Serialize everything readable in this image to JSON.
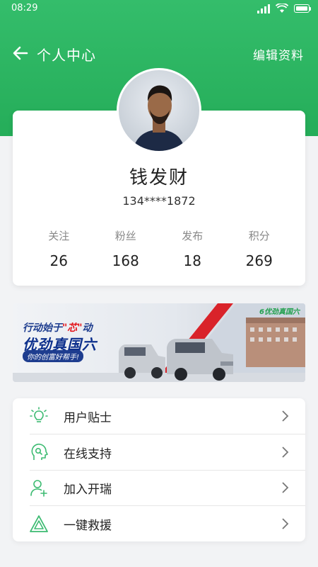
{
  "status_bar": {
    "time": "08:29"
  },
  "nav": {
    "title": "个人中心",
    "edit_label": "编辑资料"
  },
  "profile": {
    "name": "钱发财",
    "phone": "134****1872",
    "stats": [
      {
        "label": "关注",
        "value": "26"
      },
      {
        "label": "粉丝",
        "value": "168"
      },
      {
        "label": "发布",
        "value": "18"
      },
      {
        "label": "积分",
        "value": "269"
      }
    ]
  },
  "banner": {
    "line1_a": "行动始于",
    "line1_b": "\"芯\"",
    "line1_c": "动",
    "line2": "优劲真国六",
    "line3": "你的创富好帮手!",
    "logo": "6优劲真国六"
  },
  "menu": [
    {
      "label": "用户贴士",
      "icon": "lightbulb-icon"
    },
    {
      "label": "在线支持",
      "icon": "support-head-icon"
    },
    {
      "label": "加入开瑞",
      "icon": "add-user-icon"
    },
    {
      "label": "一键救援",
      "icon": "rescue-triangle-icon"
    }
  ],
  "colors": {
    "primary_green": "#2bb563",
    "icon_green": "#3dbb72"
  }
}
